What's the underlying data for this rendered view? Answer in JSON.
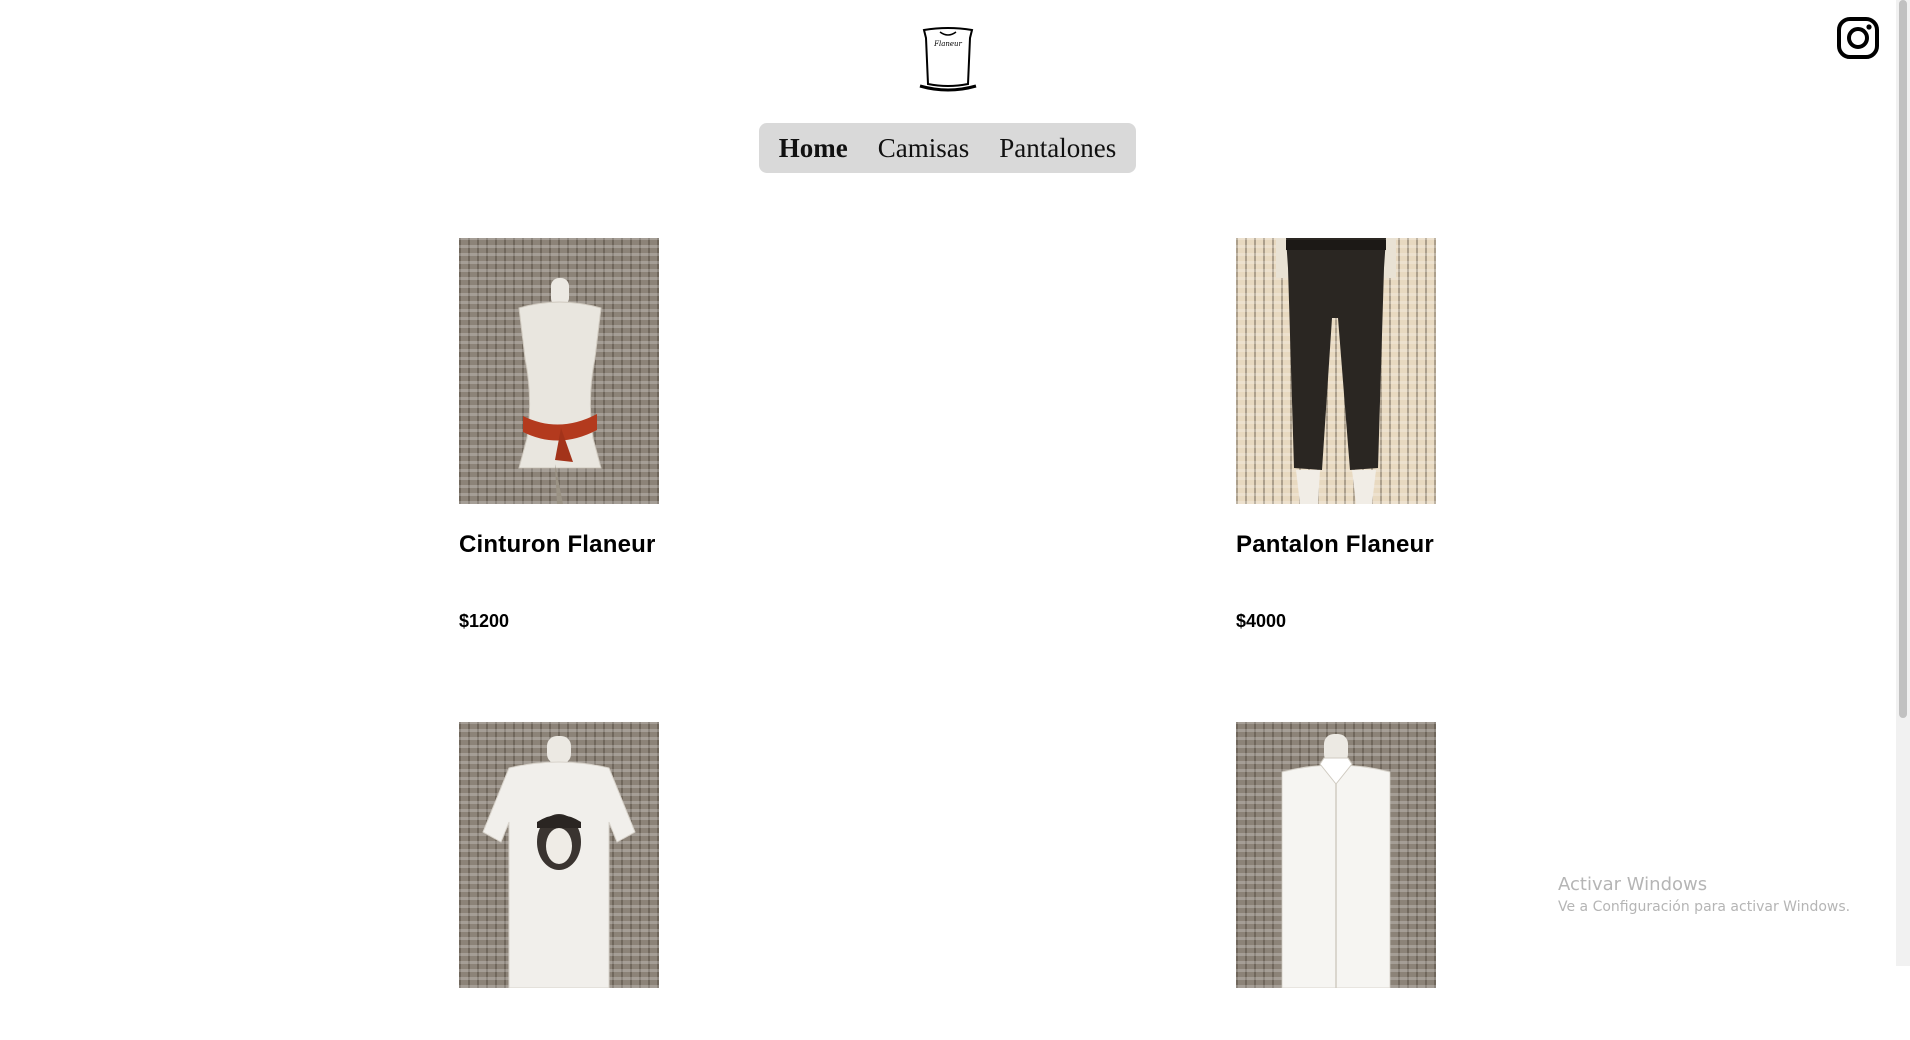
{
  "logo": {
    "text": "Flaneur",
    "icon": "shirt-logo-icon"
  },
  "social": {
    "icon": "instagram-icon"
  },
  "nav": {
    "items": [
      {
        "label": "Home",
        "active": true
      },
      {
        "label": "Camisas",
        "active": false
      },
      {
        "label": "Pantalones",
        "active": false
      }
    ]
  },
  "products": [
    {
      "title": "Cinturon Flaneur",
      "price": "$1200",
      "image": "mannequin-belt-image"
    },
    {
      "title": "Pantalon Flaneur",
      "price": "$4000",
      "image": "black-pants-image"
    },
    {
      "title": "",
      "price": "",
      "image": "graphic-tshirt-image"
    },
    {
      "title": "",
      "price": "",
      "image": "white-shirt-image"
    }
  ],
  "watermark": {
    "title": "Activar Windows",
    "subtitle": "Ve a Configuración para activar Windows."
  },
  "colors": {
    "nav_bg": "#d9d9d9",
    "text": "#000000",
    "watermark": "#b5b5b5"
  }
}
